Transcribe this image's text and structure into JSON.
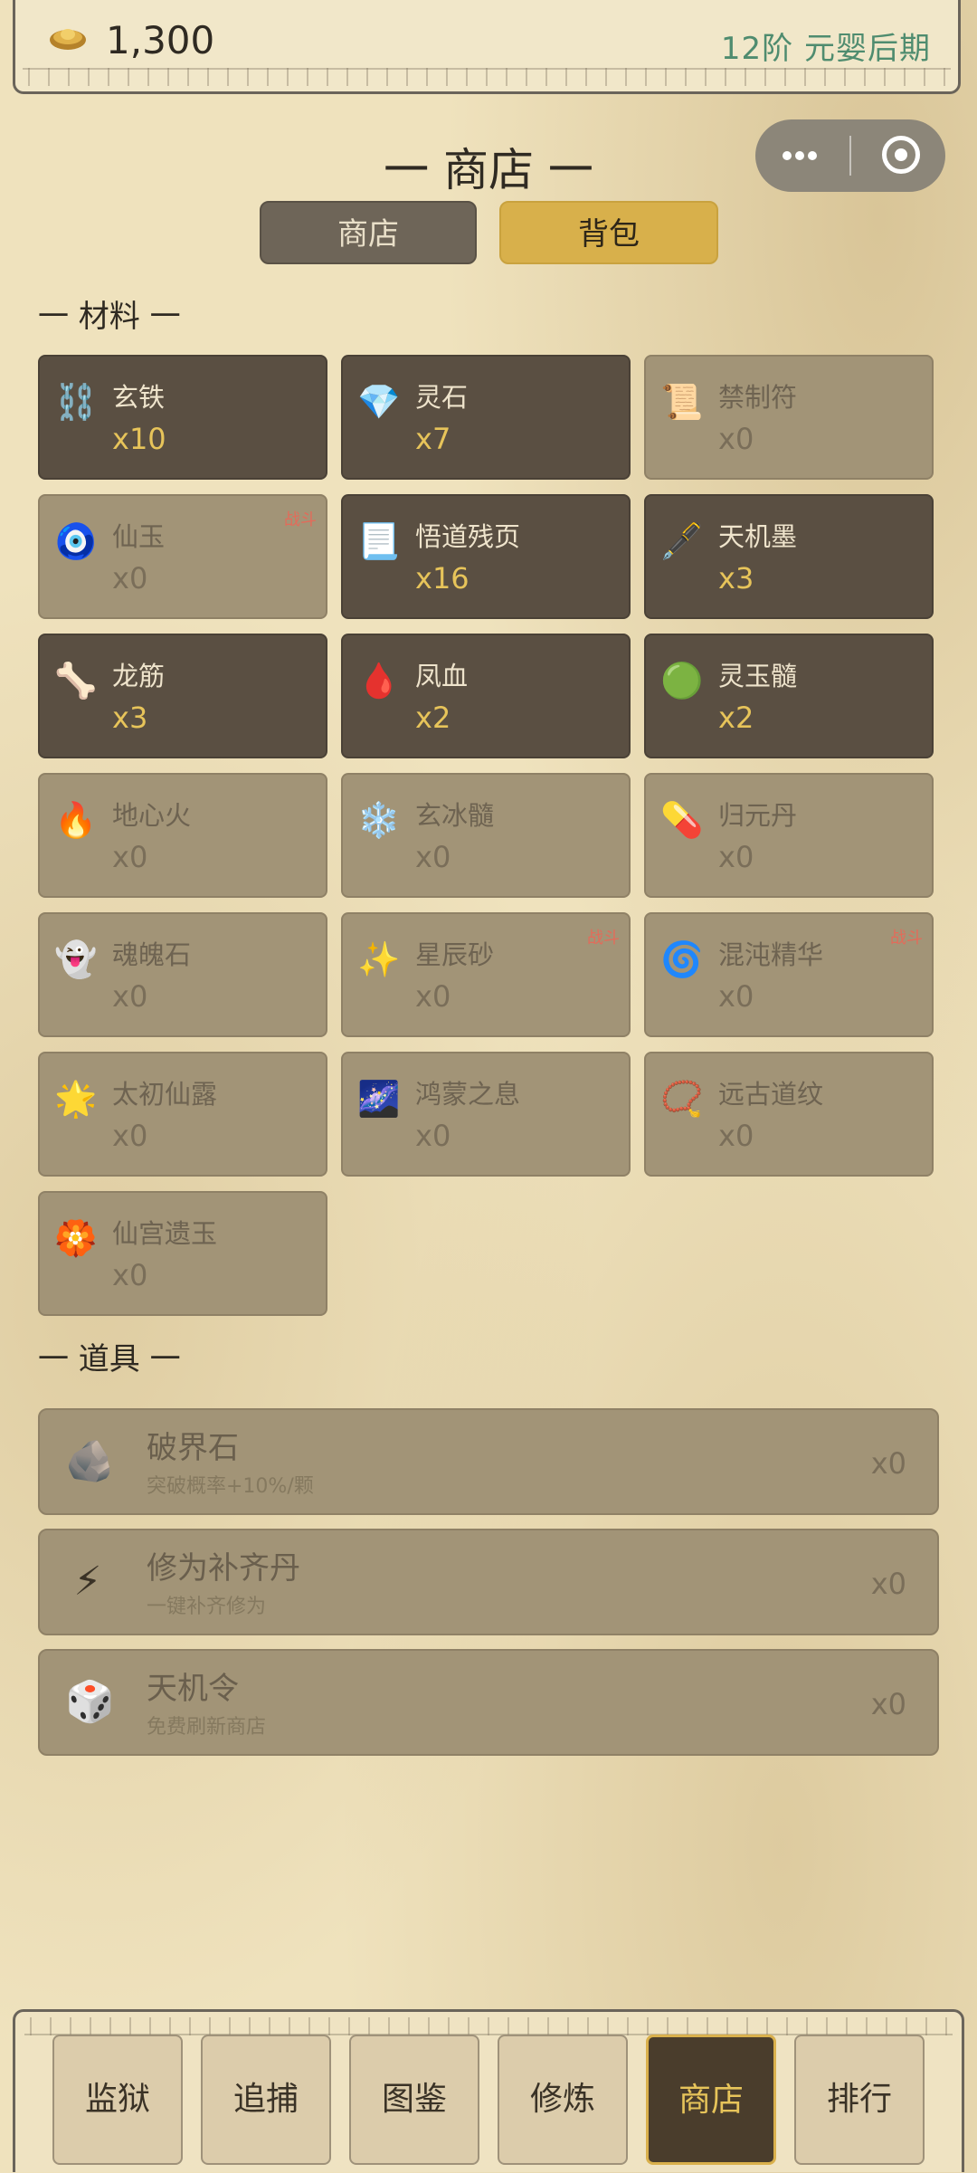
{
  "header": {
    "coin_icon": "gold-ingot-icon",
    "gold": "1,300",
    "rank": "12阶 元婴后期"
  },
  "page_title": "一 商店 一",
  "tabs": [
    {
      "label": "商店",
      "active": false
    },
    {
      "label": "背包",
      "active": true
    }
  ],
  "materials": {
    "title": "一 材料 一",
    "items": [
      {
        "icon": "⛓️",
        "icon_name": "chain-icon",
        "name": "玄铁",
        "qty": "x10",
        "owned": true,
        "badge": ""
      },
      {
        "icon": "💎",
        "icon_name": "diamond-icon",
        "name": "灵石",
        "qty": "x7",
        "owned": true,
        "badge": ""
      },
      {
        "icon": "📜",
        "icon_name": "scroll-icon",
        "name": "禁制符",
        "qty": "x0",
        "owned": false,
        "badge": ""
      },
      {
        "icon": "🧿",
        "icon_name": "hamsa-icon",
        "name": "仙玉",
        "qty": "x0",
        "owned": false,
        "badge": "战斗"
      },
      {
        "icon": "📃",
        "icon_name": "page-icon",
        "name": "悟道残页",
        "qty": "x16",
        "owned": true,
        "badge": ""
      },
      {
        "icon": "🖋️",
        "icon_name": "pen-icon",
        "name": "天机墨",
        "qty": "x3",
        "owned": true,
        "badge": ""
      },
      {
        "icon": "🦴",
        "icon_name": "bone-icon",
        "name": "龙筋",
        "qty": "x3",
        "owned": true,
        "badge": ""
      },
      {
        "icon": "🩸",
        "icon_name": "blood-drop-icon",
        "name": "凤血",
        "qty": "x2",
        "owned": true,
        "badge": ""
      },
      {
        "icon": "🟢",
        "icon_name": "green-circle-icon",
        "name": "灵玉髓",
        "qty": "x2",
        "owned": true,
        "badge": ""
      },
      {
        "icon": "🔥",
        "icon_name": "fire-icon",
        "name": "地心火",
        "qty": "x0",
        "owned": false,
        "badge": ""
      },
      {
        "icon": "❄️",
        "icon_name": "snowflake-icon",
        "name": "玄冰髓",
        "qty": "x0",
        "owned": false,
        "badge": ""
      },
      {
        "icon": "💊",
        "icon_name": "pill-icon",
        "name": "归元丹",
        "qty": "x0",
        "owned": false,
        "badge": ""
      },
      {
        "icon": "👻",
        "icon_name": "ghost-icon",
        "name": "魂魄石",
        "qty": "x0",
        "owned": false,
        "badge": ""
      },
      {
        "icon": "✨",
        "icon_name": "sparkles-icon",
        "name": "星辰砂",
        "qty": "x0",
        "owned": false,
        "badge": "战斗"
      },
      {
        "icon": "🌀",
        "icon_name": "swirl-icon",
        "name": "混沌精华",
        "qty": "x0",
        "owned": false,
        "badge": "战斗"
      },
      {
        "icon": "🌟",
        "icon_name": "glowing-star-icon",
        "name": "太初仙露",
        "qty": "x0",
        "owned": false,
        "badge": ""
      },
      {
        "icon": "🌌",
        "icon_name": "galaxy-icon",
        "name": "鸿蒙之息",
        "qty": "x0",
        "owned": false,
        "badge": ""
      },
      {
        "icon": "📿",
        "icon_name": "prayer-beads-icon",
        "name": "远古道纹",
        "qty": "x0",
        "owned": false,
        "badge": ""
      },
      {
        "icon": "🏵️",
        "icon_name": "rosette-icon",
        "name": "仙宫遗玉",
        "qty": "x0",
        "owned": false,
        "badge": ""
      }
    ]
  },
  "tools": {
    "title": "一 道具 一",
    "items": [
      {
        "icon": "🪨",
        "icon_name": "rock-icon",
        "name": "破界石",
        "desc": "突破概率+10%/颗",
        "qty": "x0"
      },
      {
        "icon": "⚡",
        "icon_name": "lightning-icon",
        "name": "修为补齐丹",
        "desc": "一键补齐修为",
        "qty": "x0"
      },
      {
        "icon": "🎲",
        "icon_name": "dice-icon",
        "name": "天机令",
        "desc": "免费刷新商店",
        "qty": "x0"
      }
    ]
  },
  "nav": [
    {
      "label": "监狱",
      "active": false
    },
    {
      "label": "追捕",
      "active": false
    },
    {
      "label": "图鉴",
      "active": false
    },
    {
      "label": "修炼",
      "active": false
    },
    {
      "label": "商店",
      "active": true
    },
    {
      "label": "排行",
      "active": false
    }
  ]
}
